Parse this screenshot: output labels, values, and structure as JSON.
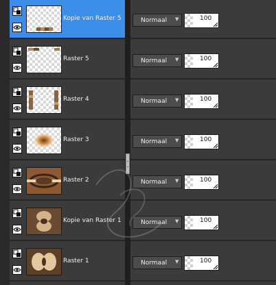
{
  "layers_panel": {
    "rows": [
      {
        "name": "Kopie van Raster 5",
        "blend_mode": "Normaal",
        "opacity": "100",
        "selected": true
      },
      {
        "name": "Raster 5",
        "blend_mode": "Normaal",
        "opacity": "100",
        "selected": false
      },
      {
        "name": "Raster 4",
        "blend_mode": "Normaal",
        "opacity": "100",
        "selected": false
      },
      {
        "name": "Raster 3",
        "blend_mode": "Normaal",
        "opacity": "100",
        "selected": false
      },
      {
        "name": "Raster 2",
        "blend_mode": "Normaal",
        "opacity": "100",
        "selected": false
      },
      {
        "name": "Kopie van Raster 1",
        "blend_mode": "Normaal",
        "opacity": "100",
        "selected": false
      },
      {
        "name": "Raster 1",
        "blend_mode": "Normaal",
        "opacity": "100",
        "selected": false
      }
    ]
  },
  "colors": {
    "selected_row": "#3d8ee9",
    "row_bg": "#3b3b3b",
    "separator": "#262626",
    "splitter": "#1f1f1f"
  },
  "icons": {
    "layer_type_icon": "raster-layer-icon",
    "visibility_icon": "eye-icon",
    "dropdown_icon": "chevron-down-icon",
    "splitter_handle": "splitter-handle"
  }
}
